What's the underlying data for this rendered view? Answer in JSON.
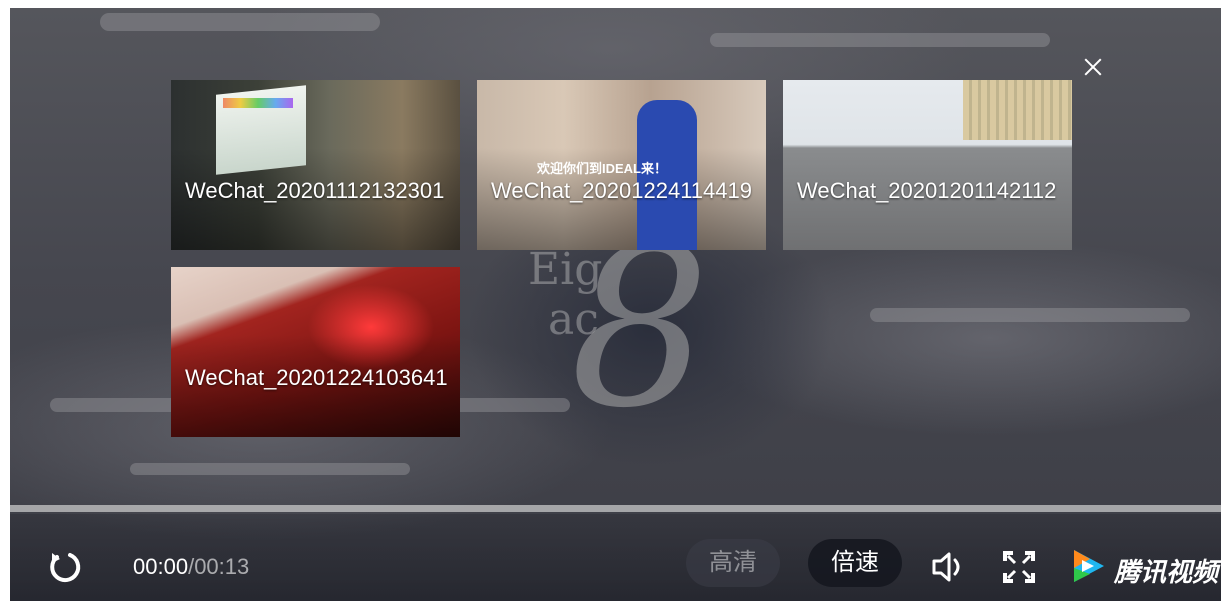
{
  "playlist": {
    "items": [
      {
        "title": "WeChat_20201112132301"
      },
      {
        "title": "WeChat_20201224114419",
        "overlay_text": "欢迎你们到IDEAL来！"
      },
      {
        "title": "WeChat_20201201142112"
      },
      {
        "title": "WeChat_20201224103641"
      }
    ]
  },
  "background": {
    "text_line1": "Eig",
    "text_line2": "ac",
    "glyph": "8"
  },
  "controls": {
    "current_time": "00:00",
    "separator": "/",
    "duration": "00:13",
    "quality_label": "高清",
    "speed_label": "倍速",
    "progress": 0.0
  },
  "brand": {
    "name": "腾讯视频"
  },
  "icons": {
    "close": "close-icon",
    "replay": "replay-icon",
    "volume": "volume-icon",
    "fullscreen": "fullscreen-icon",
    "logo": "tencent-video-logo"
  }
}
